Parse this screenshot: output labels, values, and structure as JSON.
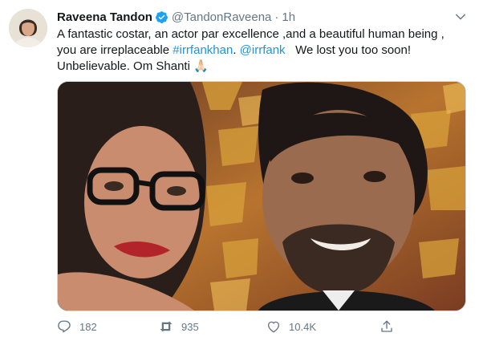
{
  "tweet": {
    "author_name": "Raveena Tandon",
    "handle": "@TandonRaveena",
    "separator": "·",
    "time": "1h",
    "text_line1": "A fantastic costar, an actor par excellence ,and a beautiful human being ,",
    "text_line2_pre": "you are irreplaceable ",
    "hashtag": "#irrfankhan",
    "text_line2_mid": ". ",
    "mention": "@irrfank",
    "text_line2_post": "   We lost you too soon!",
    "text_line3": "Unbelievable. Om Shanti 🙏🏻"
  },
  "actions": {
    "replies": "182",
    "retweets": "935",
    "likes": "10.4K"
  },
  "colors": {
    "link": "#1b95e0",
    "verified": "#1da1f2",
    "muted": "#657786"
  },
  "icons": {
    "verified": "verified-badge-icon",
    "caret": "chevron-down-icon",
    "reply": "reply-icon",
    "retweet": "retweet-icon",
    "like": "heart-icon",
    "share": "share-icon"
  }
}
